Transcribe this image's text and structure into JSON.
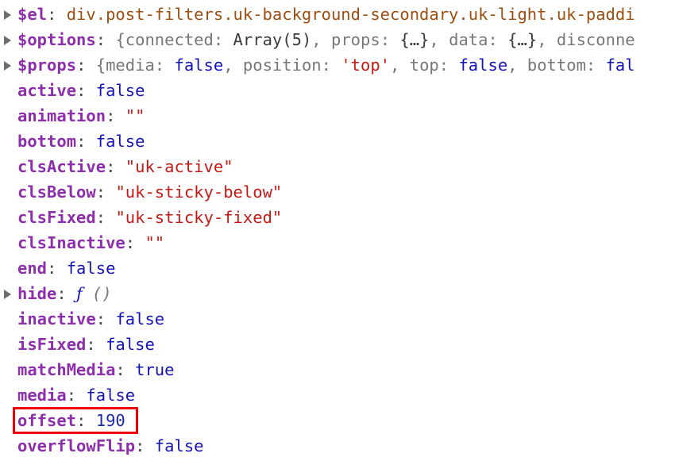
{
  "inspector": {
    "kind": "devtools-object-properties",
    "rows": [
      {
        "expandable": true,
        "name": "$el",
        "segments": [
          {
            "style": "elem",
            "text": "div.post-filters.uk-background-secondary.uk-light.uk-paddi"
          }
        ]
      },
      {
        "expandable": true,
        "name": "$options",
        "segments": [
          {
            "style": "plain",
            "text": "{connected: "
          },
          {
            "style": "dark",
            "text": "Array(5)"
          },
          {
            "style": "plain",
            "text": ", props: "
          },
          {
            "style": "dark",
            "text": "{…}"
          },
          {
            "style": "plain",
            "text": ", data: "
          },
          {
            "style": "dark",
            "text": "{…}"
          },
          {
            "style": "plain",
            "text": ", disconne"
          }
        ]
      },
      {
        "expandable": true,
        "name": "$props",
        "segments": [
          {
            "style": "plain",
            "text": "{media: "
          },
          {
            "style": "bool",
            "text": "false"
          },
          {
            "style": "plain",
            "text": ", position: "
          },
          {
            "style": "string",
            "text": "'top'"
          },
          {
            "style": "plain",
            "text": ", top: "
          },
          {
            "style": "bool",
            "text": "false"
          },
          {
            "style": "plain",
            "text": ", bottom: "
          },
          {
            "style": "bool",
            "text": "fal"
          }
        ]
      },
      {
        "expandable": false,
        "name": "active",
        "segments": [
          {
            "style": "bool",
            "text": "false"
          }
        ]
      },
      {
        "expandable": false,
        "name": "animation",
        "segments": [
          {
            "style": "string",
            "text": "\"\""
          }
        ]
      },
      {
        "expandable": false,
        "name": "bottom",
        "segments": [
          {
            "style": "bool",
            "text": "false"
          }
        ]
      },
      {
        "expandable": false,
        "name": "clsActive",
        "segments": [
          {
            "style": "string",
            "text": "\"uk-active\""
          }
        ]
      },
      {
        "expandable": false,
        "name": "clsBelow",
        "segments": [
          {
            "style": "string",
            "text": "\"uk-sticky-below\""
          }
        ]
      },
      {
        "expandable": false,
        "name": "clsFixed",
        "segments": [
          {
            "style": "string",
            "text": "\"uk-sticky-fixed\""
          }
        ]
      },
      {
        "expandable": false,
        "name": "clsInactive",
        "segments": [
          {
            "style": "string",
            "text": "\"\""
          }
        ]
      },
      {
        "expandable": false,
        "name": "end",
        "segments": [
          {
            "style": "bool",
            "text": "false"
          }
        ]
      },
      {
        "expandable": true,
        "name": "hide",
        "segments": [
          {
            "style": "fn",
            "text": "ƒ"
          },
          {
            "style": "fnparen",
            "text": " ()"
          }
        ]
      },
      {
        "expandable": false,
        "name": "inactive",
        "segments": [
          {
            "style": "bool",
            "text": "false"
          }
        ]
      },
      {
        "expandable": false,
        "name": "isFixed",
        "segments": [
          {
            "style": "bool",
            "text": "false"
          }
        ]
      },
      {
        "expandable": false,
        "name": "matchMedia",
        "segments": [
          {
            "style": "bool",
            "text": "true"
          }
        ]
      },
      {
        "expandable": false,
        "name": "media",
        "segments": [
          {
            "style": "bool",
            "text": "false"
          }
        ]
      },
      {
        "expandable": false,
        "name": "offset",
        "highlighted": true,
        "segments": [
          {
            "style": "num",
            "text": "190"
          }
        ]
      },
      {
        "expandable": false,
        "name": "overflowFlip",
        "segments": [
          {
            "style": "bool",
            "text": "false"
          }
        ]
      }
    ],
    "separator": ":",
    "highlight": {
      "target": "offset",
      "color": "#ee0000"
    }
  }
}
